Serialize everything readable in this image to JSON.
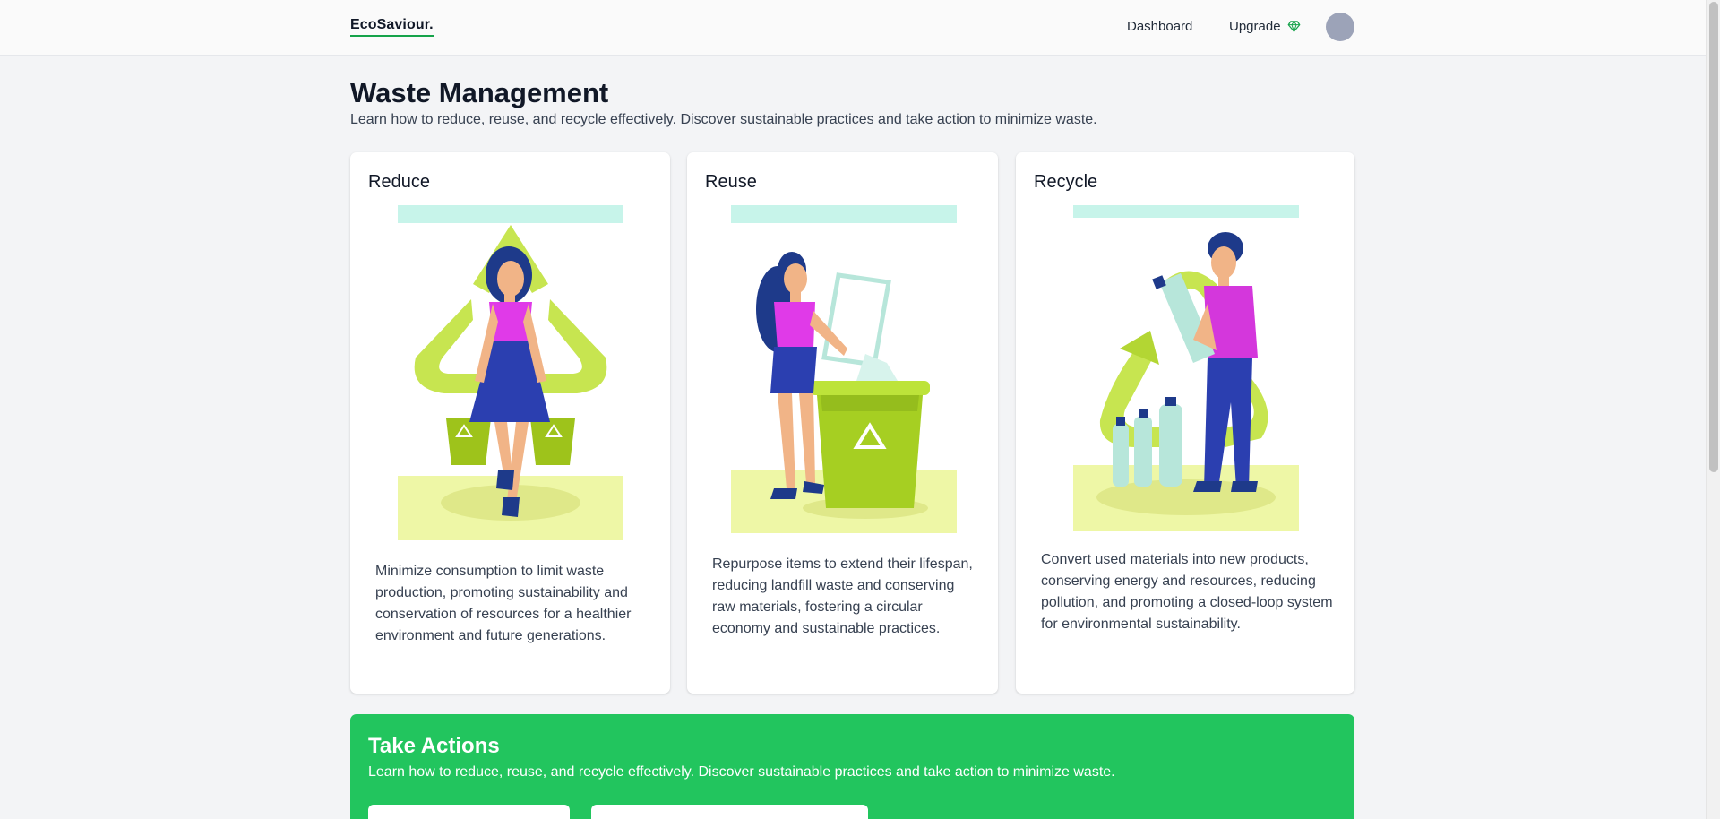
{
  "header": {
    "brand": "EcoSaviour.",
    "nav": {
      "dashboard": "Dashboard",
      "upgrade": "Upgrade",
      "upgrade_icon": "gem-icon"
    },
    "avatar_color": "#9ca3b8"
  },
  "page": {
    "title": "Waste Management",
    "subtitle": "Learn how to reduce, reuse, and recycle effectively. Discover sustainable practices and take action to minimize waste."
  },
  "cards": [
    {
      "title": "Reduce",
      "illustration": "woman-with-recycle-bins-illustration",
      "text": "Minimize consumption to limit waste production, promoting sustainability and conservation of resources for a healthier environment and future generations."
    },
    {
      "title": "Reuse",
      "illustration": "woman-putting-item-in-bin-illustration",
      "text": "Repurpose items to extend their lifespan, reducing landfill waste and conserving raw materials, fostering a circular economy and sustainable practices."
    },
    {
      "title": "Recycle",
      "illustration": "man-recycling-bottles-illustration",
      "text": "Convert used materials into new products, conserving energy and resources, reducing pollution, and promoting a closed-loop system for environmental sustainability."
    }
  ],
  "actions": {
    "title": "Take Actions",
    "subtitle": "Learn how to reduce, reuse, and recycle effectively. Discover sustainable practices and take action to minimize waste.",
    "background": "#22c55e"
  },
  "colors": {
    "brand_underline": "#16a34a",
    "accent_green": "#22c55e",
    "page_bg": "#f3f4f6"
  }
}
